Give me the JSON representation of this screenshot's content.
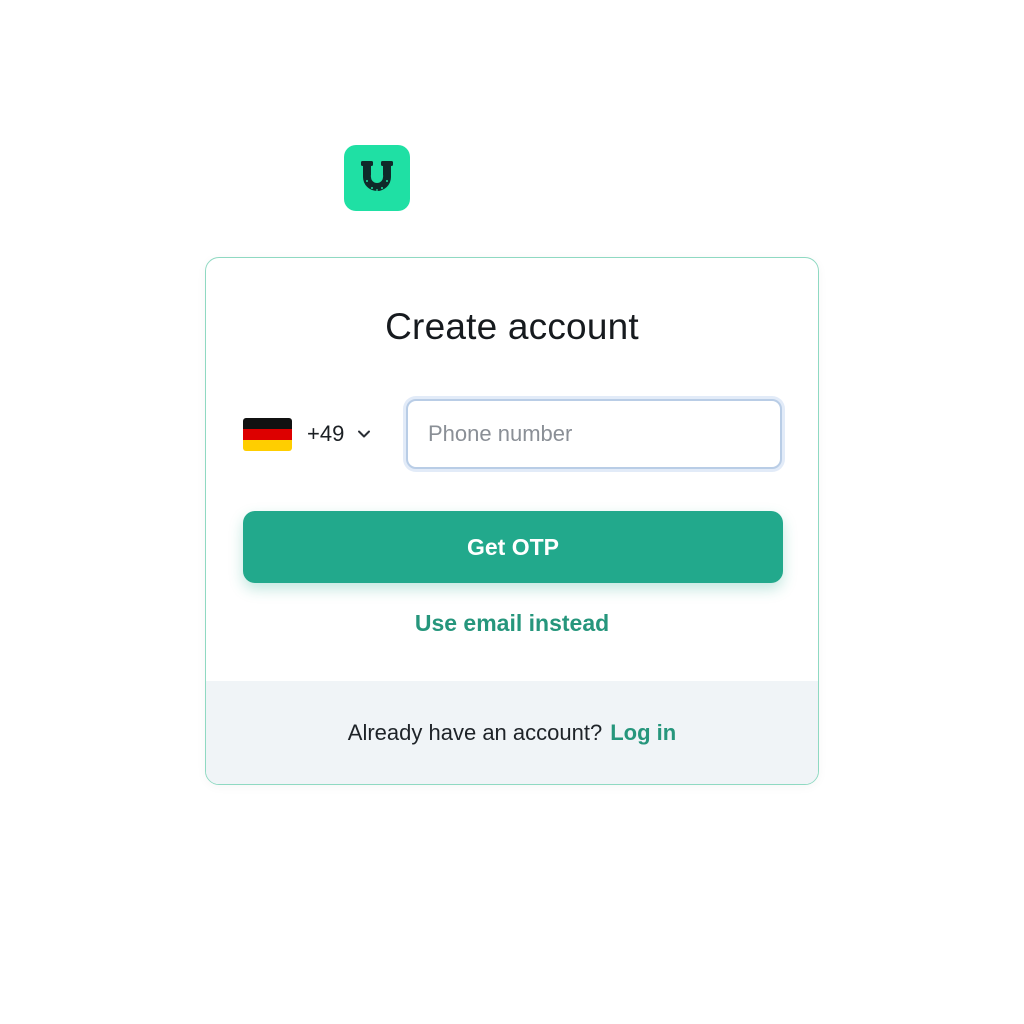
{
  "app": {
    "logo_icon": "horseshoe-icon",
    "logo_color": "#1fe0a4"
  },
  "form": {
    "title": "Create account",
    "country": {
      "flag_icon": "germany-flag-icon",
      "dial_code": "+49"
    },
    "phone": {
      "value": "",
      "placeholder": "Phone number"
    },
    "submit_label": "Get OTP",
    "alt_link_label": "Use email instead"
  },
  "footer": {
    "prompt": "Already have an account?",
    "login_label": "Log in"
  },
  "colors": {
    "primary": "#22a98c",
    "link": "#26967c",
    "footer_bg": "#f0f4f7"
  }
}
